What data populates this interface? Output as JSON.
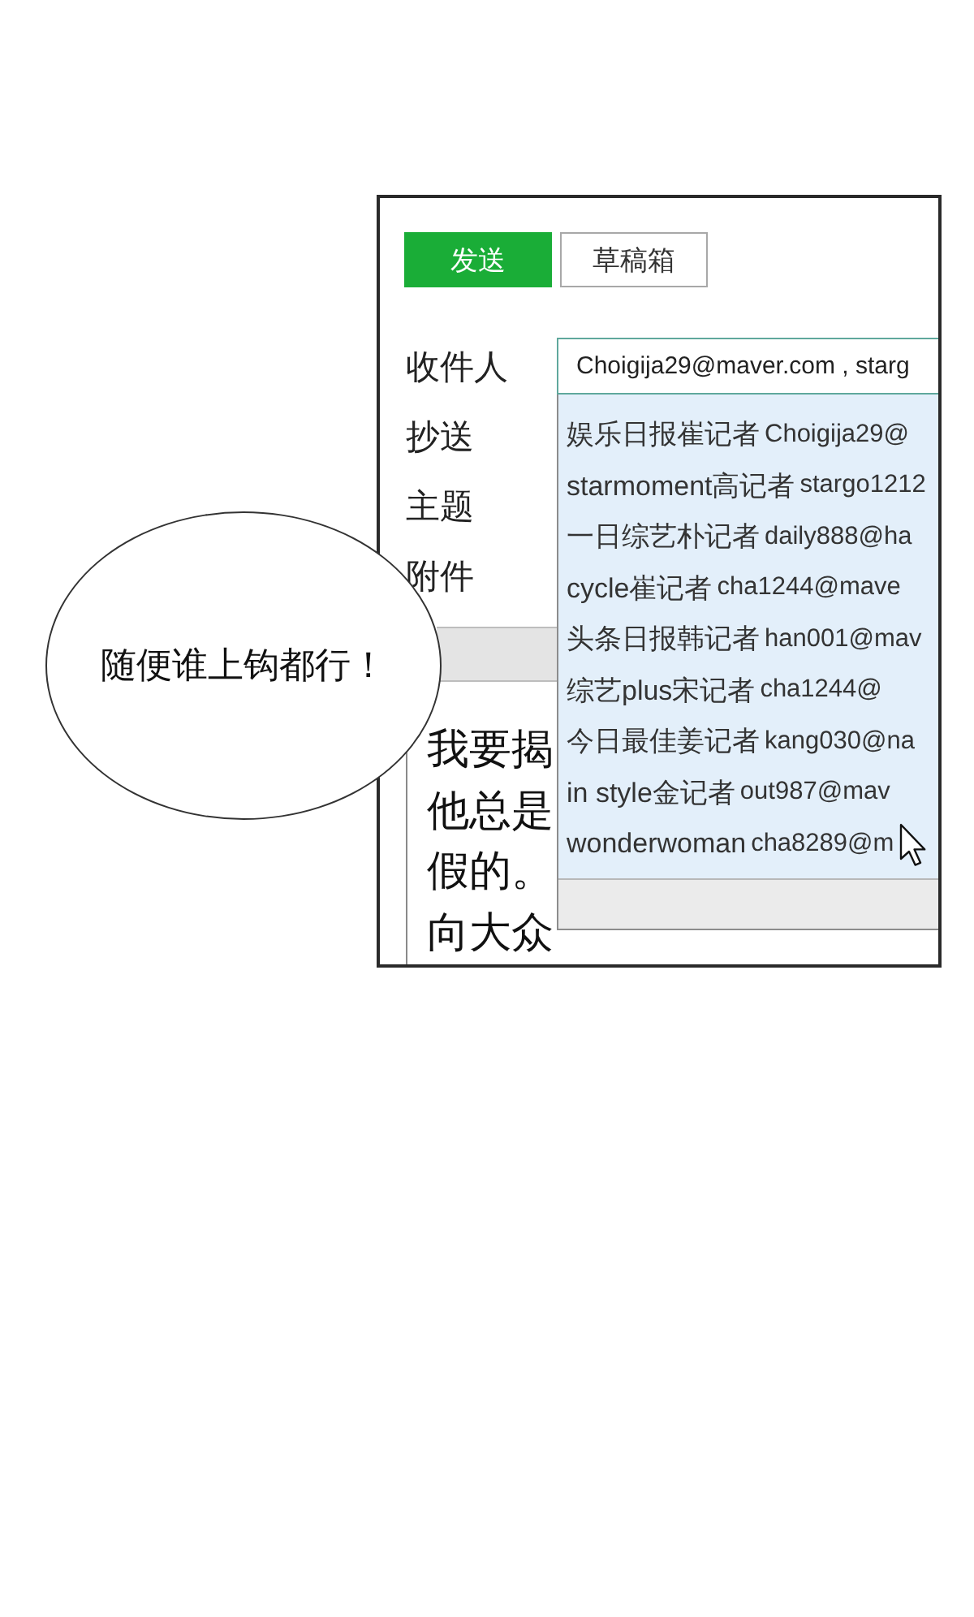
{
  "bubble": {
    "text": "随便谁上钩都行！"
  },
  "compose": {
    "buttons": [
      {
        "label": "发送",
        "kind": "primary"
      },
      {
        "label": "草稿箱",
        "kind": "secondary"
      }
    ],
    "fields": [
      {
        "label": "收件人",
        "value": "Choigija29@maver.com , starg"
      },
      {
        "label": "抄送"
      },
      {
        "label": "主题"
      },
      {
        "label": "附件"
      }
    ],
    "suggestions": [
      {
        "name": "娱乐日报崔记者",
        "email": "Choigija29@"
      },
      {
        "name": "starmoment高记者",
        "email": "stargo1212"
      },
      {
        "name": "一日综艺朴记者",
        "email": "daily888@ha"
      },
      {
        "name": "cycle崔记者",
        "email": "cha1244@mave"
      },
      {
        "name": "头条日报韩记者",
        "email": "han001@mav"
      },
      {
        "name": "综艺plus宋记者",
        "email": "cha1244@"
      },
      {
        "name": "今日最佳姜记者",
        "email": "kang030@na"
      },
      {
        "name": "in style金记者",
        "email": "out987@mav"
      },
      {
        "name": "wonderwoman",
        "email": "cha8289@m"
      }
    ],
    "body": {
      "lines": [
        "我要揭",
        "他总是",
        "假的。",
        "向大众"
      ]
    }
  }
}
